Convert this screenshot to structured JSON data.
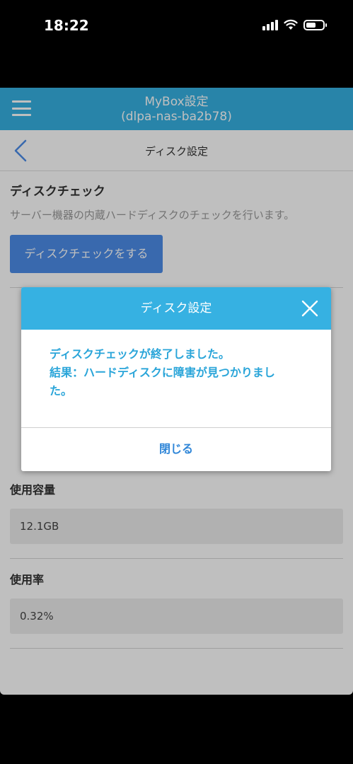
{
  "status_bar": {
    "time": "18:22"
  },
  "header": {
    "title_line1": "MyBox設定",
    "title_line2": "(dlpa-nas-ba2b78)"
  },
  "subheader": {
    "title": "ディスク設定"
  },
  "disk_check": {
    "heading": "ディスクチェック",
    "description": "サーバー機器の内蔵ハードディスクのチェックを行います。",
    "button_label": "ディスクチェックをする"
  },
  "fields": {
    "used_capacity": {
      "label": "使用容量",
      "value": "12.1GB"
    },
    "usage_rate": {
      "label": "使用率",
      "value": "0.32%"
    }
  },
  "modal": {
    "title": "ディスク設定",
    "message_line1": "ディスクチェックが終了しました。",
    "message_line2": "結果：ハードディスクに障害が見つかりまし",
    "message_line3": "た。",
    "close_label": "閉じる"
  },
  "colors": {
    "accent": "#36b1e2",
    "button": "#4c8de8",
    "link": "#2f86d8"
  }
}
